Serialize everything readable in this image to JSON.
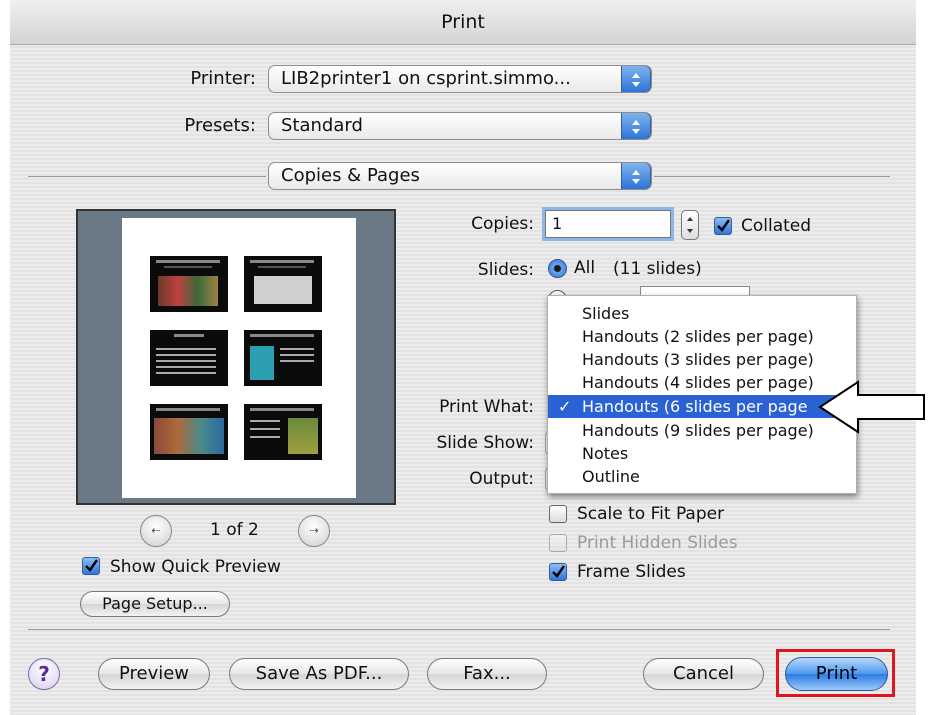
{
  "window": {
    "title": "Print"
  },
  "printer": {
    "label": "Printer:",
    "value": "LIB2printer1 on csprint.simmo..."
  },
  "presets": {
    "label": "Presets:",
    "value": "Standard"
  },
  "panel": {
    "value": "Copies & Pages"
  },
  "copies": {
    "label": "Copies:",
    "value": "1",
    "collated_label": "Collated",
    "collated": true
  },
  "slides": {
    "label": "Slides:",
    "all_label": "All",
    "count": "(11 slides)"
  },
  "print_what": {
    "label": "Print What:",
    "options": [
      "Slides",
      "Handouts (2 slides per page)",
      "Handouts (3 slides per page)",
      "Handouts (4 slides per page)",
      "Handouts (6 slides per page)",
      "Handouts (9 slides per page)",
      "Notes",
      "Outline"
    ],
    "selected_index": 4,
    "selected_visible": "Handouts (6 slides per page"
  },
  "slide_show": {
    "label": "Slide Show:"
  },
  "output": {
    "label": "Output:"
  },
  "options": {
    "scale_to_fit": "Scale to Fit Paper",
    "print_hidden": "Print Hidden Slides",
    "frame_slides": "Frame Slides"
  },
  "preview": {
    "page_indicator": "1 of 2",
    "show_quick_preview": "Show Quick Preview",
    "prev_icon": "arrow-left-icon",
    "next_icon": "arrow-right-icon"
  },
  "page_setup": {
    "label": "Page Setup..."
  },
  "buttons": {
    "help": "?",
    "preview": "Preview",
    "save_pdf": "Save As PDF...",
    "fax": "Fax...",
    "cancel": "Cancel",
    "print": "Print"
  },
  "colors": {
    "accent": "#2a62d6",
    "highlight_box": "#e0161e"
  }
}
